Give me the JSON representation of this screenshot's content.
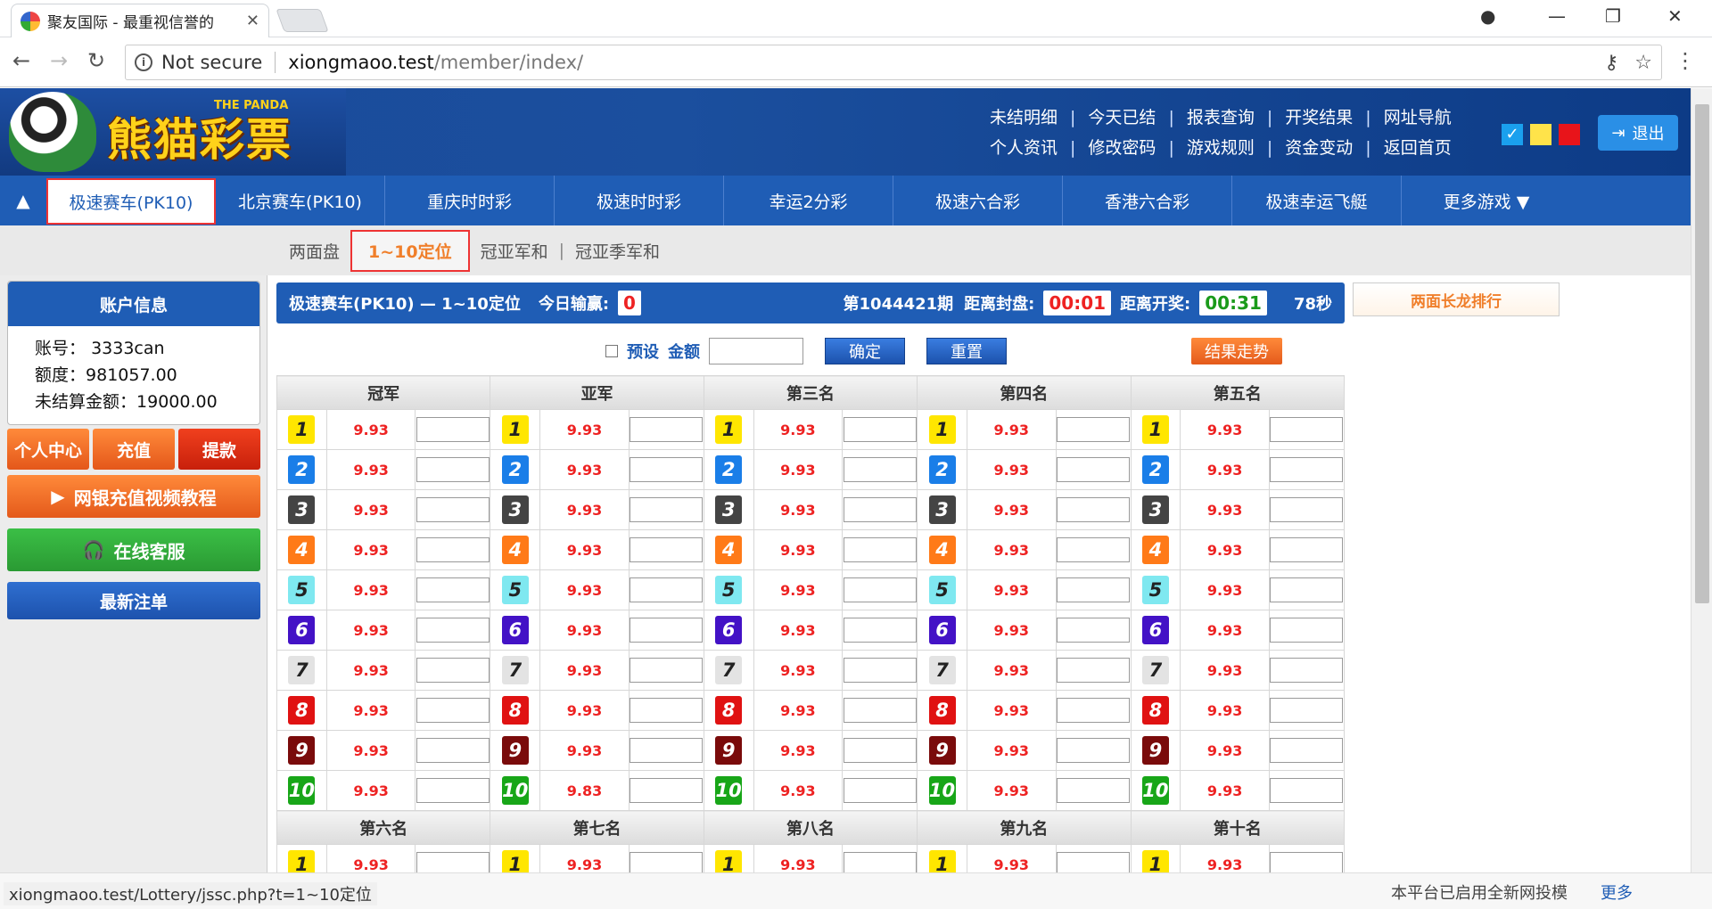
{
  "browser": {
    "tab_title": "聚友国际 - 最重视信誉的",
    "not_secure": "Not secure",
    "url_host": "xiongmaoo.test",
    "url_path": "/member/index/"
  },
  "header": {
    "logo_text": "熊猫彩票",
    "logo_sub": "THE PANDA",
    "links_row1": [
      "未结明细",
      "今天已结",
      "报表查询",
      "开奖结果",
      "网址导航"
    ],
    "links_row2": [
      "个人资讯",
      "修改密码",
      "游戏规则",
      "资金变动",
      "返回首页"
    ],
    "swatch_colors": [
      "#1aa0ee",
      "#ffe34a",
      "#e8141a"
    ],
    "logout_label": "退出"
  },
  "games": [
    "极速赛车(PK10)",
    "北京赛车(PK10)",
    "重庆时时彩",
    "极速时时彩",
    "幸运2分彩",
    "极速六合彩",
    "香港六合彩",
    "极速幸运飞艇",
    "更多游戏 ▼"
  ],
  "subtabs": [
    "两面盘",
    "1~10定位",
    "冠亚军和",
    "冠亚季军和"
  ],
  "account": {
    "title": "账户信息",
    "acct_label": "账号：",
    "acct_value": "3333can",
    "credit_label": "额度：",
    "credit_value": "981057.00",
    "unsettled_label": "未结算金额：",
    "unsettled_value": "19000.00"
  },
  "sidebar_buttons": {
    "center": "个人中心",
    "recharge": "充值",
    "withdraw": "提款",
    "video": "网银充值视频教程",
    "service": "在线客服",
    "latest": "最新注单"
  },
  "infobar": {
    "title": "极速赛车(PK10) — 1~10定位",
    "today_label": "今日输赢:",
    "today_value": "0",
    "period": "第1044421期",
    "close_label": "距离封盘:",
    "close_value": "00:01",
    "draw_label": "距离开奖:",
    "draw_value": "00:31",
    "seconds": "78秒",
    "rank_label": "两面长龙排行"
  },
  "controls": {
    "preset": "预设",
    "amount": "金额",
    "confirm": "确定",
    "reset": "重置",
    "trend": "结果走势"
  },
  "columns_top": [
    "冠军",
    "亚军",
    "第三名",
    "第四名",
    "第五名"
  ],
  "columns_bottom": [
    "第六名",
    "第七名",
    "第八名",
    "第九名",
    "第十名"
  ],
  "odds": [
    [
      "9.93",
      "9.93",
      "9.93",
      "9.93",
      "9.93"
    ],
    [
      "9.93",
      "9.93",
      "9.93",
      "9.93",
      "9.93"
    ],
    [
      "9.93",
      "9.93",
      "9.93",
      "9.93",
      "9.93"
    ],
    [
      "9.93",
      "9.93",
      "9.93",
      "9.93",
      "9.93"
    ],
    [
      "9.93",
      "9.93",
      "9.93",
      "9.93",
      "9.93"
    ],
    [
      "9.93",
      "9.93",
      "9.93",
      "9.93",
      "9.93"
    ],
    [
      "9.93",
      "9.93",
      "9.93",
      "9.93",
      "9.93"
    ],
    [
      "9.93",
      "9.93",
      "9.93",
      "9.93",
      "9.93"
    ],
    [
      "9.93",
      "9.93",
      "9.93",
      "9.93",
      "9.93"
    ],
    [
      "9.93",
      "9.83",
      "9.93",
      "9.93",
      "9.93"
    ]
  ],
  "bottom_first_odds": [
    "9.93",
    "9.93",
    "9.93",
    "9.93",
    "9.93"
  ],
  "status": {
    "hover_url": "xiongmaoo.test/Lottery/jssc.php?t=1~10定位",
    "notice": "本平台已启用全新网投模",
    "more": "更多"
  }
}
